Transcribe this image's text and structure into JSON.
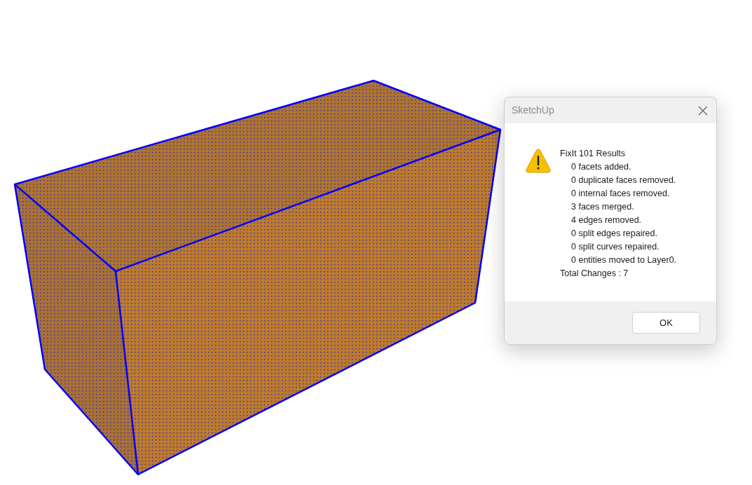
{
  "dialog": {
    "title": "SketchUp",
    "heading": "FixIt 101 Results",
    "lines": [
      "0 facets added.",
      "0 duplicate faces removed.",
      "0 internal faces removed.",
      "3 faces merged.",
      "4 edges removed.",
      "0 split edges repaired.",
      "0 split curves repaired.",
      "0 entities moved to Layer0."
    ],
    "total": "Total Changes : 7",
    "buttons": [
      "OK"
    ]
  }
}
